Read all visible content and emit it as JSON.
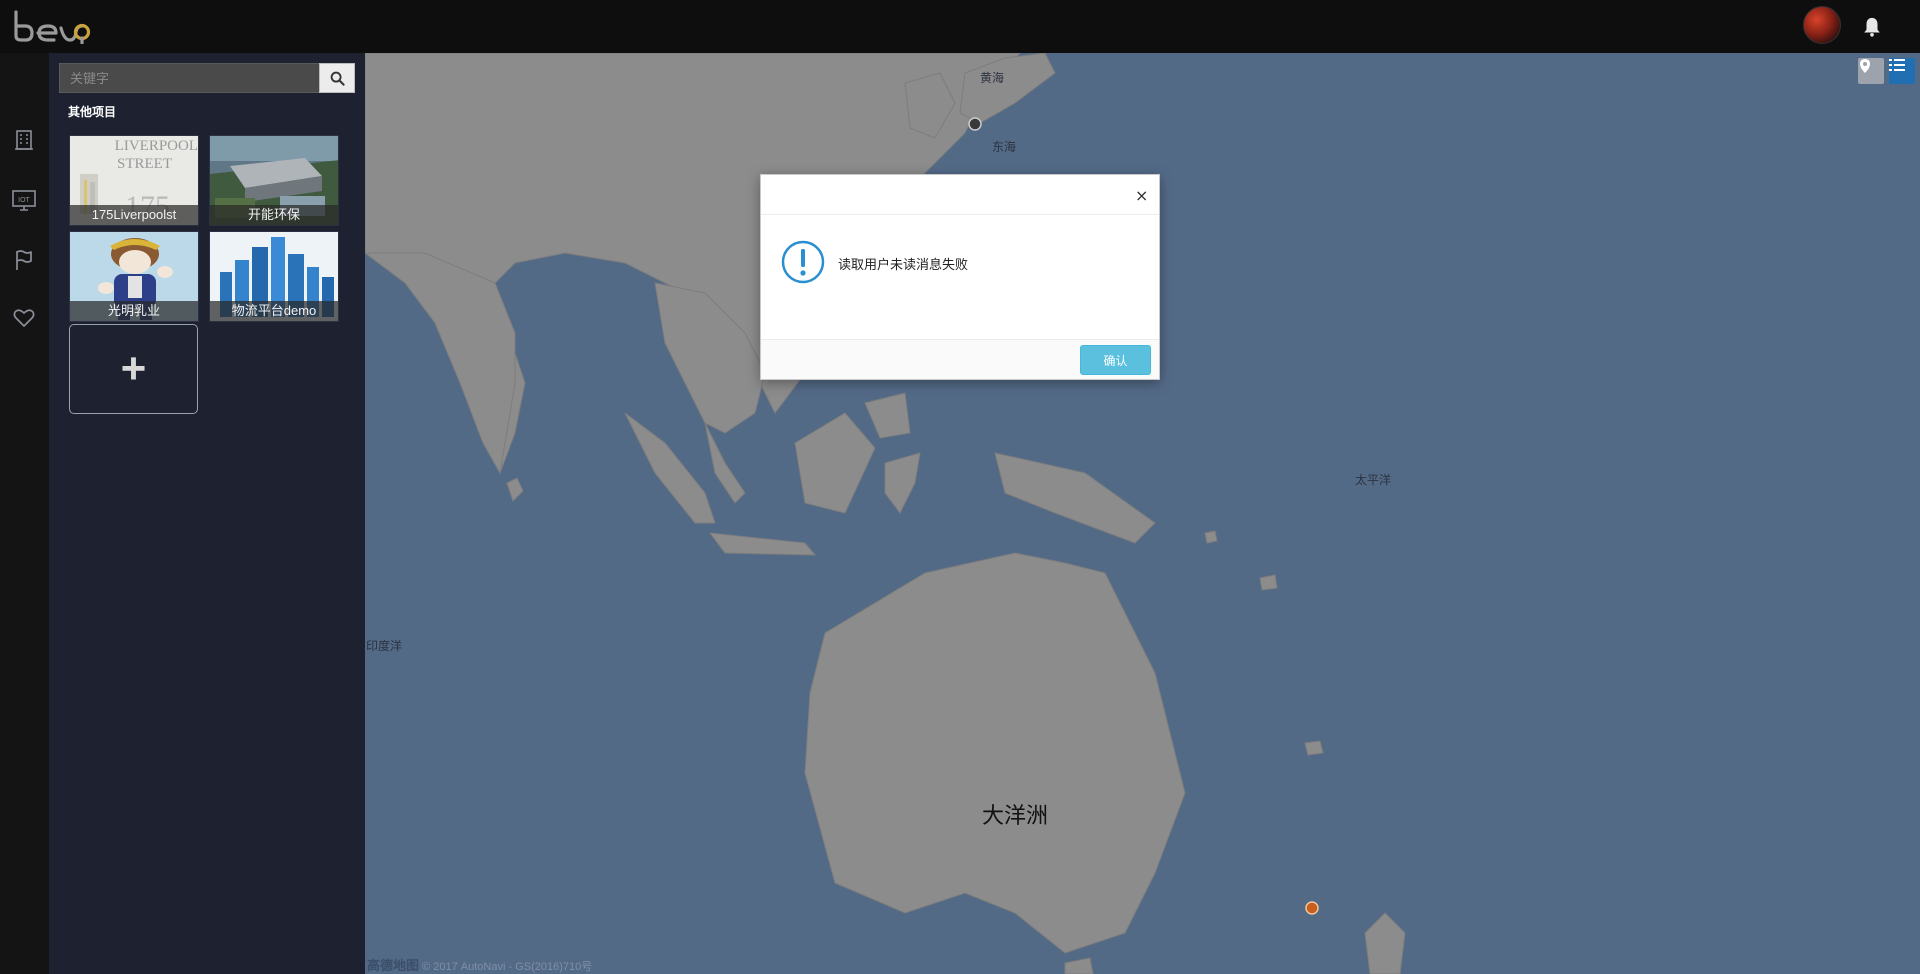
{
  "header": {
    "logo_text": "beop",
    "avatar_icon": "user-avatar",
    "notification_icon": "bell-icon"
  },
  "rail": {
    "items": [
      {
        "icon": "building-icon"
      },
      {
        "icon": "iot-monitor-icon",
        "label": "IOT"
      },
      {
        "icon": "flag-icon"
      },
      {
        "icon": "heart-icon"
      }
    ]
  },
  "panel": {
    "search": {
      "placeholder": "关键字",
      "value": "",
      "button_icon": "search-icon"
    },
    "section_title": "其他项目",
    "projects": [
      {
        "label": "175Liverpoolst",
        "thumb_text_1": "LIVERPOOL",
        "thumb_text_2": "STREET",
        "thumb_text_3": "175"
      },
      {
        "label": "开能环保"
      },
      {
        "label": "光明乳业"
      },
      {
        "label": "物流平台demo"
      }
    ],
    "add_label": "+"
  },
  "map": {
    "labels": {
      "yellow_sea": "黄海",
      "east_sea": "东海",
      "pacific": "太平洋",
      "indian_ocean": "印度洋",
      "oceania": "大洋洲"
    },
    "controls": [
      {
        "icon": "map-pin-icon"
      },
      {
        "icon": "list-icon"
      }
    ],
    "credit_brand": "高德地图",
    "credit_text": "© 2017 AutoNavi - GS(2016)710号",
    "colors": {
      "sea": "#536a87",
      "land": "#8c8c8c",
      "marker_dark": "#3a3a3a",
      "marker_orange": "#c8601d"
    }
  },
  "modal": {
    "close_label": "×",
    "icon": "warning-circle-icon",
    "message": "读取用户未读消息失败",
    "confirm_label": "确认",
    "accent": "#5bc0de"
  }
}
